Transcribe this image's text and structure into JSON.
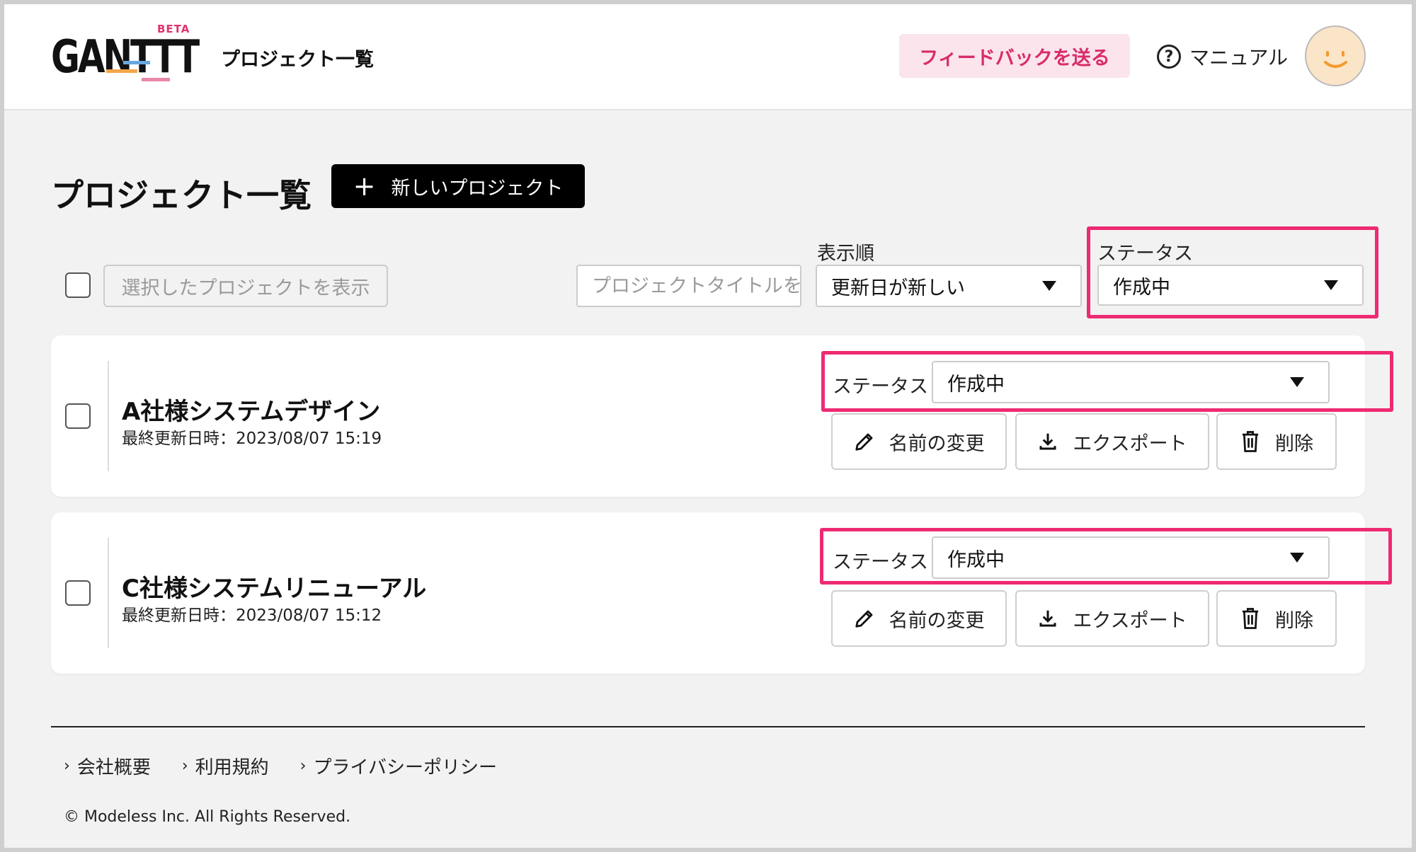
{
  "header": {
    "logo_text": "GANTTT",
    "logo_badge": "BETA",
    "title": "プロジェクト一覧",
    "feedback_label": "フィードバックを送る",
    "manual_label": "マニュアル",
    "help_icon_glyph": "?"
  },
  "page": {
    "title": "プロジェクト一覧",
    "new_project_label": "新しいプロジェクト"
  },
  "filters": {
    "show_selected_label": "選択したプロジェクトを表示",
    "search_placeholder": "プロジェクトタイトルを",
    "sort_label": "表示順",
    "sort_value": "更新日が新しい",
    "status_label": "ステータス",
    "status_value": "作成中"
  },
  "projects": [
    {
      "name": "A社様システムデザイン",
      "updated": "最終更新日時：2023/08/07 15:19",
      "status_label": "ステータス",
      "status_value": "作成中",
      "rename_label": "名前の変更",
      "export_label": "エクスポート",
      "delete_label": "削除"
    },
    {
      "name": "C社様システムリニューアル",
      "updated": "最終更新日時：2023/08/07 15:12",
      "status_label": "ステータス",
      "status_value": "作成中",
      "rename_label": "名前の変更",
      "export_label": "エクスポート",
      "delete_label": "削除"
    }
  ],
  "footer": {
    "links": [
      "会社概要",
      "利用規約",
      "プライバシーポリシー"
    ],
    "copyright": "© Modeless Inc. All Rights Reserved."
  },
  "colors": {
    "accent": "#ee2a73",
    "feedback_bg": "#fbe4ec",
    "feedback_text": "#d92b6a",
    "primary_button": "#000000",
    "background": "#f2f2f2"
  }
}
